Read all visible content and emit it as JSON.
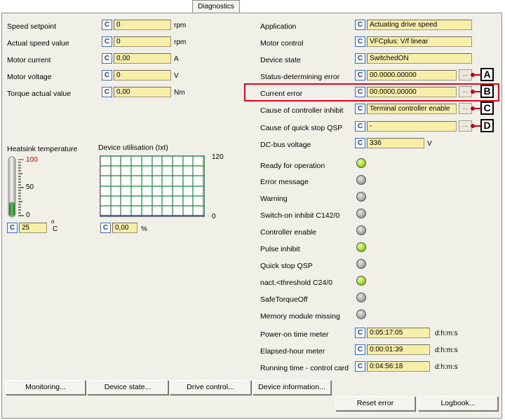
{
  "tab": "Diagnostics",
  "left": [
    {
      "label": "Speed setpoint",
      "value": "0",
      "unit": "rpm"
    },
    {
      "label": "Actual speed value",
      "value": "0",
      "unit": "rpm"
    },
    {
      "label": "Motor current",
      "value": "0,00",
      "unit": "A"
    },
    {
      "label": "Motor voltage",
      "value": "0",
      "unit": "V"
    },
    {
      "label": "Torque actual value",
      "value": "0,00",
      "unit": "Nm"
    }
  ],
  "right": [
    {
      "label": "Application",
      "value": "Actuating drive speed"
    },
    {
      "label": "Motor control",
      "value": "VFCplus: V/f linear"
    },
    {
      "label": "Device state",
      "value": "SwitchedON"
    },
    {
      "label": "Status-determining error",
      "value": "00.0000.00000"
    },
    {
      "label": "Current error",
      "value": "00.0000.00000"
    },
    {
      "label": "Cause of controller inhibit",
      "value": "Terminal controller enable"
    },
    {
      "label": "Cause of quick stop QSP",
      "value": "-"
    },
    {
      "label": "DC-bus voltage",
      "value": "336",
      "unit": "V"
    }
  ],
  "c_label": "C",
  "dots_label": "...",
  "callouts": [
    "A",
    "B",
    "C",
    "D"
  ],
  "heatsink": {
    "title": "Heatsink temperature",
    "scale_top": "100",
    "scale_mid": "50",
    "scale_bottom": "0",
    "value": "25",
    "unit_top": "o",
    "unit_main": "C",
    "fill_fraction": 0.25
  },
  "utilisation": {
    "title": "Device utilisation (Ixt)",
    "scale_max": "120",
    "scale_min": "0",
    "value": "0,00",
    "unit": "%"
  },
  "status": [
    {
      "label": "Ready for operation",
      "state": "on"
    },
    {
      "label": "Error message",
      "state": "off"
    },
    {
      "label": "Warning",
      "state": "off"
    },
    {
      "label": "Switch-on inhibit C142/0",
      "state": "off"
    },
    {
      "label": "Controller enable",
      "state": "off"
    },
    {
      "label": "Pulse inhibit",
      "state": "on"
    },
    {
      "label": "Quick stop QSP",
      "state": "off"
    },
    {
      "label": "nact.<threshold C24/0",
      "state": "on"
    },
    {
      "label": "SafeTorqueOff",
      "state": "off"
    },
    {
      "label": "Memory module missing",
      "state": "off"
    }
  ],
  "meters": [
    {
      "label": "Power-on time meter",
      "value": "0:05:17:05",
      "unit": "d:h:m:s"
    },
    {
      "label": "Elapsed-hour meter",
      "value": "0:00:01:39",
      "unit": "d:h:m:s"
    },
    {
      "label": "Running time - control card",
      "value": "0:04:56:18",
      "unit": "d:h:m:s"
    }
  ],
  "buttons": {
    "monitoring": "Monitoring...",
    "device_state": "Device state...",
    "drive_control": "Drive control...",
    "device_information": "Device information...",
    "reset_error": "Reset error",
    "logbook": "Logbook..."
  },
  "colors": {
    "field_bg": "#f7eeaa",
    "highlight": "#e0001a",
    "led_on": "#9ad81a",
    "led_off": "#a8a8a8"
  }
}
